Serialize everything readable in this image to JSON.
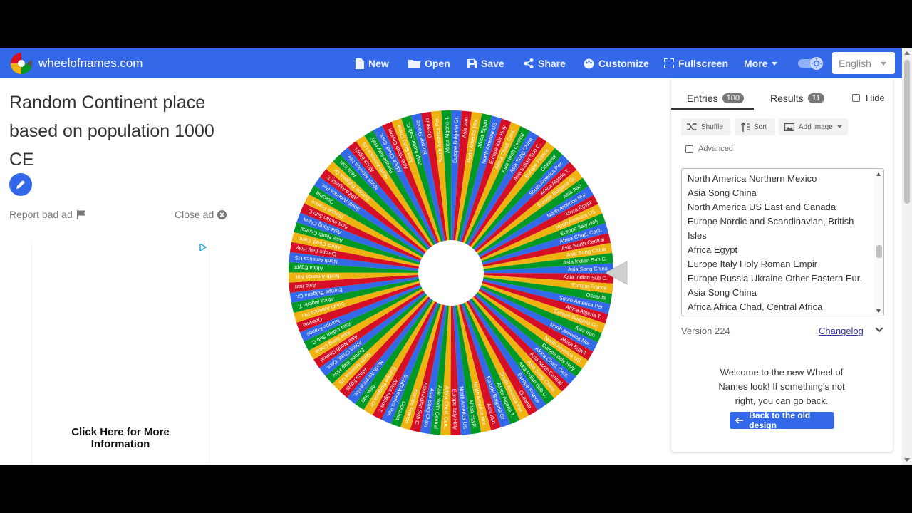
{
  "header": {
    "brand": "wheelofnames.com",
    "nav": [
      {
        "label": "New",
        "icon": "file-icon"
      },
      {
        "label": "Open",
        "icon": "folder-icon"
      },
      {
        "label": "Save",
        "icon": "floppy-icon"
      },
      {
        "label": "Share",
        "icon": "share-icon"
      },
      {
        "label": "Customize",
        "icon": "palette-icon"
      },
      {
        "label": "Fullscreen",
        "icon": "fullscreen-icon"
      },
      {
        "label": "More",
        "icon": "caret-down-icon"
      }
    ],
    "theme_toggle": "on",
    "language": "English",
    "bar_color": "#3369e8"
  },
  "left": {
    "title": "Random Continent place based on population 1000 CE",
    "report_label": "Report bad ad",
    "close_label": "Close ad",
    "ad_text": "Click Here for More Information"
  },
  "wheel": {
    "colors": [
      "#3369e8",
      "#d50f25",
      "#eeb211",
      "#009925"
    ],
    "visible_labels": [
      "Asia Song China",
      "Asia Indian Sub C.",
      "Europe France",
      "Oceania",
      "South America Per.",
      "Africa Algeria T.",
      "Europe Bulgaria Gr.",
      "Asia Iran",
      "North America Nor.",
      "Africa Egypt",
      "North America US",
      "Europe Italy Holy",
      "Africa Chad, Cent.",
      "Asia North Central"
    ]
  },
  "panel": {
    "tabs": [
      {
        "label": "Entries",
        "count": "100"
      },
      {
        "label": "Results",
        "count": "11"
      }
    ],
    "hide_label": "Hide",
    "tools": {
      "shuffle": "Shuffle",
      "sort": "Sort",
      "add_image": "Add image"
    },
    "advanced_label": "Advanced",
    "entries": [
      "North America Northern Mexico",
      "Asia Song China",
      "North America US East and Canada",
      "Europe Nordic and Scandinavian, British",
      "Isles",
      "Africa Egypt",
      "Europe Italy Holy Roman Empir",
      "Europe Russia Ukraine Other Eastern Eur.",
      "Asia Song China",
      "Africa Africa Chad, Central Africa"
    ],
    "version": "Version 224",
    "changelog": "Changelog",
    "welcome": "Welcome to the new Wheel of Names look! If something's not right, you can go back.",
    "back_button": "Back to the old design"
  }
}
